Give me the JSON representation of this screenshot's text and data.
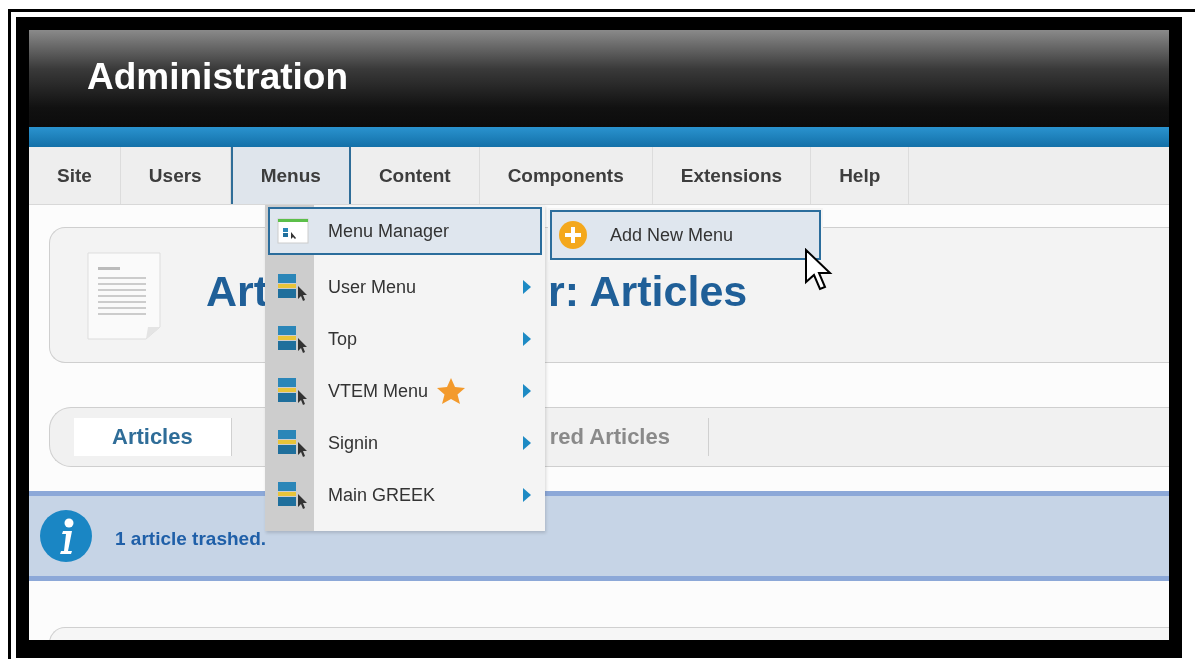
{
  "header": {
    "title": "Administration"
  },
  "nav": [
    {
      "label": "Site",
      "selected": false
    },
    {
      "label": "Users",
      "selected": false
    },
    {
      "label": "Menus",
      "selected": true
    },
    {
      "label": "Content",
      "selected": false
    },
    {
      "label": "Components",
      "selected": false
    },
    {
      "label": "Extensions",
      "selected": false
    },
    {
      "label": "Help",
      "selected": false
    }
  ],
  "dropdown": {
    "items": [
      {
        "label": "Menu Manager",
        "kind": "manager",
        "selected": true,
        "has_submenu": false,
        "starred": false
      },
      {
        "label": "User Menu",
        "kind": "menu",
        "selected": false,
        "has_submenu": true,
        "starred": false
      },
      {
        "label": "Top",
        "kind": "menu",
        "selected": false,
        "has_submenu": true,
        "starred": false
      },
      {
        "label": "VTEM Menu",
        "kind": "menu",
        "selected": false,
        "has_submenu": true,
        "starred": true
      },
      {
        "label": "Signin",
        "kind": "menu",
        "selected": false,
        "has_submenu": true,
        "starred": false
      },
      {
        "label": "Main GREEK",
        "kind": "menu",
        "selected": false,
        "has_submenu": true,
        "starred": false
      }
    ]
  },
  "submenu": {
    "items": [
      {
        "label": "Add New Menu",
        "selected": true
      }
    ]
  },
  "page": {
    "title_start": "Art",
    "title_end": "r: Articles"
  },
  "tabs": [
    {
      "label": "Articles",
      "selected": true
    },
    {
      "label": "red Articles",
      "selected": false
    }
  ],
  "message": {
    "text": "1 article trashed."
  }
}
